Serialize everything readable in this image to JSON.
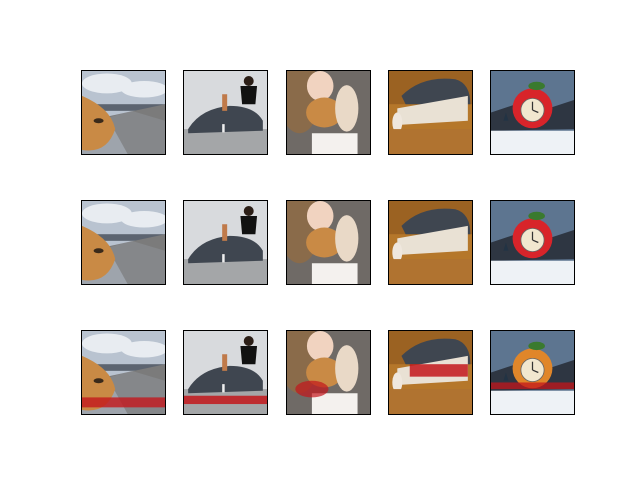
{
  "figure": {
    "rows": 3,
    "columns": 5,
    "column_subjects": [
      "train-on-bridge-with-animal-face",
      "skateboarder-over-elephant",
      "woman-holding-dogs",
      "elephant-over-crates",
      "apple-shaped-clock-in-snow"
    ],
    "palette": {
      "frame": "#000000",
      "sky": "#b9c3d0",
      "cloud": "#e8ecf1",
      "road": "#7b7b7b",
      "elephant": "#3f4650",
      "wood": "#b5772a",
      "apple": "#d8242a",
      "clock_face": "#f1e7cf",
      "snow": "#eef2f6",
      "dog": "#c98a45",
      "skin": "#f1d3c0",
      "artifact_red": "#c3161b"
    }
  }
}
